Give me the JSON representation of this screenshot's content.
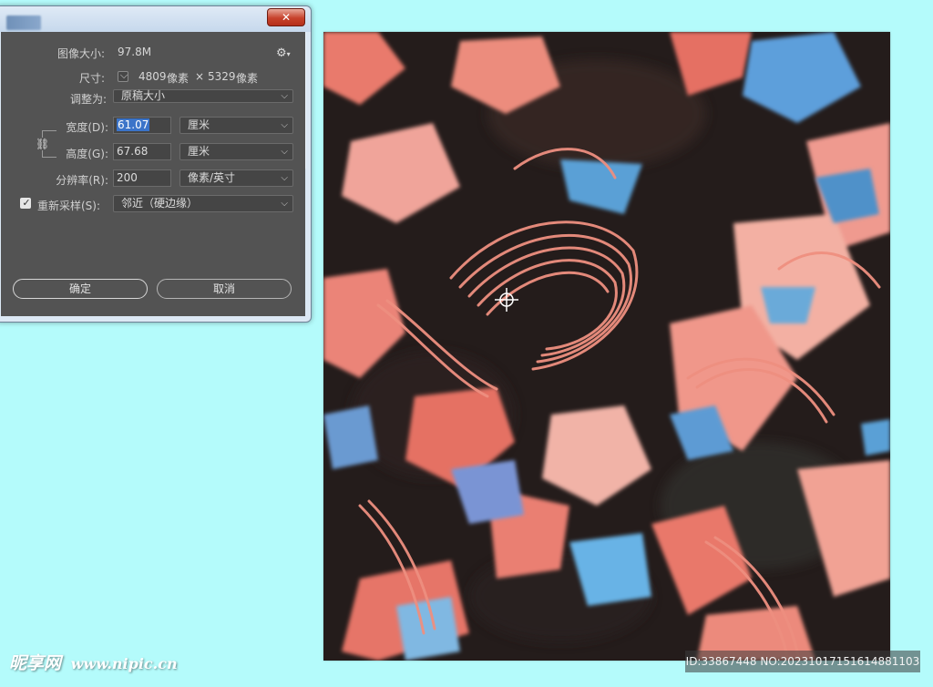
{
  "dialog": {
    "close_symbol": "✕",
    "image_size_label": "图像大小:",
    "image_size_value": "97.8M",
    "settings_icon": "gear-icon",
    "dimensions_label": "尺寸:",
    "dimensions_width": "4809",
    "dimensions_unit1": "像素",
    "dimensions_times": "×",
    "dimensions_height": "5329",
    "dimensions_unit2": "像素",
    "fit_to_label": "调整为:",
    "fit_to_value": "原稿大小",
    "width_label": "宽度(D):",
    "width_value": "61.07",
    "width_unit": "厘米",
    "height_label": "高度(G):",
    "height_value": "67.68",
    "height_unit": "厘米",
    "resolution_label": "分辨率(R):",
    "resolution_value": "200",
    "resolution_unit": "像素/英寸",
    "resample_label": "重新采样(S):",
    "resample_checked": true,
    "resample_value": "邻近（硬边缘）",
    "ok_button": "确定",
    "cancel_button": "取消"
  },
  "watermark": {
    "logo_text": "昵享网",
    "url": "www.nipic.cn"
  },
  "image_id": "ID:33867448 NO:20231017151614881103",
  "colors": {
    "desktop": "#b4fbfb",
    "panel": "#535353",
    "accent_selection": "#3b74c9",
    "pattern_dark": "#241c1b",
    "pattern_coral": "#e9786a",
    "pattern_blue": "#5a9fd9"
  }
}
